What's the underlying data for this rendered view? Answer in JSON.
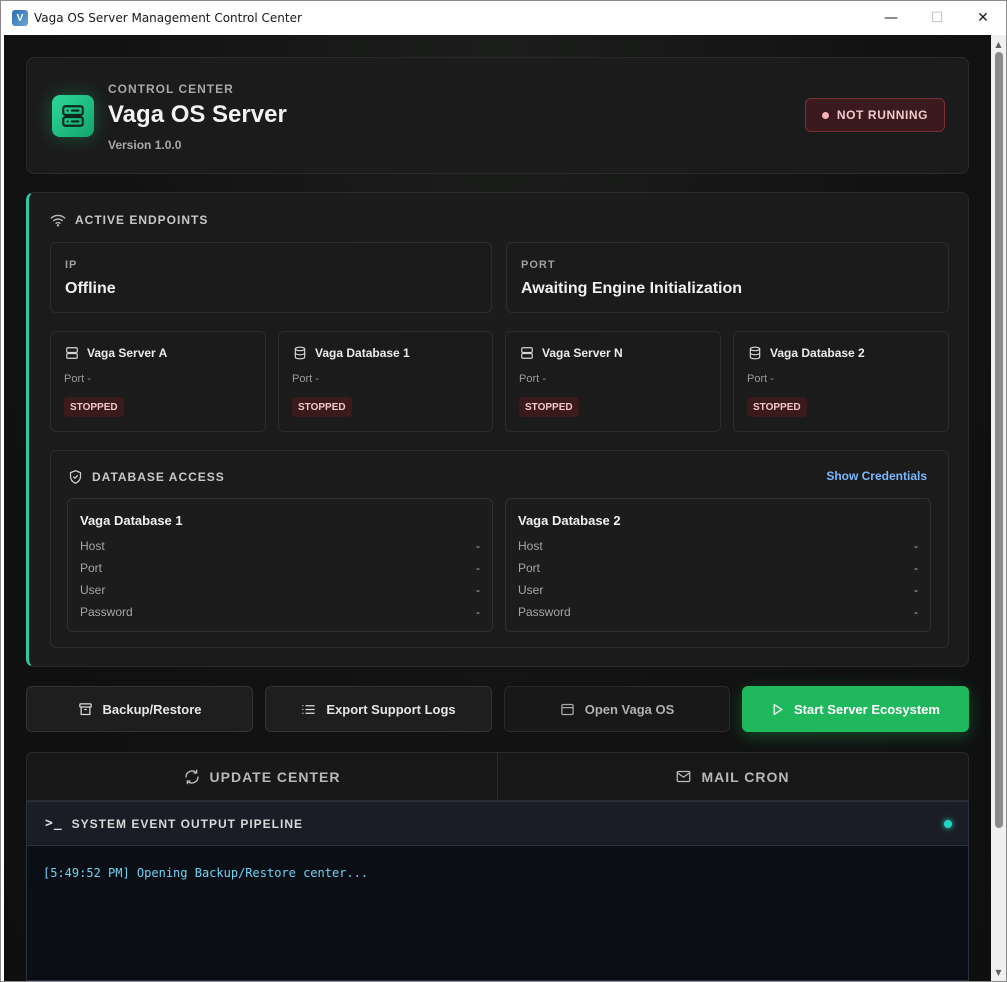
{
  "window": {
    "title": "Vaga OS Server Management Control Center",
    "minimize": "—",
    "maximize": "☐",
    "close": "✕"
  },
  "header": {
    "eyebrow": "CONTROL CENTER",
    "title": "Vaga OS Server",
    "version": "Version 1.0.0",
    "status": "NOT RUNNING"
  },
  "endpoints": {
    "section_label": "ACTIVE ENDPOINTS",
    "ip": {
      "label": "IP",
      "value": "Offline"
    },
    "port": {
      "label": "PORT",
      "value": "Awaiting Engine Initialization"
    },
    "services": [
      {
        "name": "Vaga Server A",
        "icon": "server-icon",
        "port": "Port -",
        "status": "STOPPED"
      },
      {
        "name": "Vaga Database 1",
        "icon": "database-icon",
        "port": "Port -",
        "status": "STOPPED"
      },
      {
        "name": "Vaga Server N",
        "icon": "server-icon",
        "port": "Port -",
        "status": "STOPPED"
      },
      {
        "name": "Vaga Database 2",
        "icon": "database-icon",
        "port": "Port -",
        "status": "STOPPED"
      }
    ]
  },
  "database_access": {
    "section_label": "DATABASE ACCESS",
    "show_credentials": "Show Credentials",
    "databases": [
      {
        "title": "Vaga Database 1",
        "rows": [
          {
            "label": "Host",
            "value": "-"
          },
          {
            "label": "Port",
            "value": "-"
          },
          {
            "label": "User",
            "value": "-"
          },
          {
            "label": "Password",
            "value": "-"
          }
        ]
      },
      {
        "title": "Vaga Database 2",
        "rows": [
          {
            "label": "Host",
            "value": "-"
          },
          {
            "label": "Port",
            "value": "-"
          },
          {
            "label": "User",
            "value": "-"
          },
          {
            "label": "Password",
            "value": "-"
          }
        ]
      }
    ]
  },
  "actions": {
    "backup": "Backup/Restore",
    "export_logs": "Export Support Logs",
    "open_os": "Open Vaga OS",
    "start": "Start Server Ecosystem"
  },
  "tabs": [
    {
      "label": "UPDATE CENTER",
      "icon": "refresh-icon"
    },
    {
      "label": "MAIL CRON",
      "icon": "mail-icon"
    }
  ],
  "console": {
    "title": "SYSTEM EVENT OUTPUT PIPELINE",
    "prompt": ">_",
    "lines": [
      "[5:49:52 PM] Opening Backup/Restore center..."
    ]
  },
  "colors": {
    "accent_green": "#1fb85d",
    "accent_teal": "#2ec8a8",
    "status_red": "#7a2f36",
    "link_blue": "#79b8ff",
    "console_text": "#6fd3f2"
  }
}
